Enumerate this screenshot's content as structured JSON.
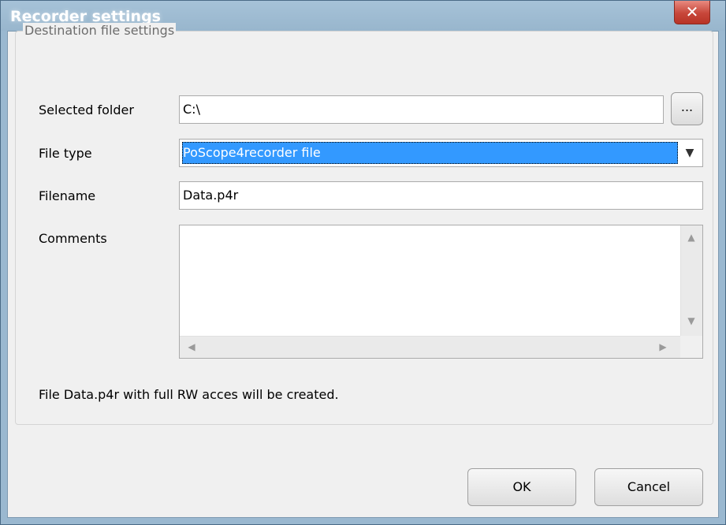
{
  "window": {
    "title": "Recorder settings",
    "close_symbol": "✕"
  },
  "group": {
    "legend": "Destination file settings"
  },
  "fields": {
    "folder_label": "Selected folder",
    "folder_value": "C:\\",
    "browse_label": "...",
    "filetype_label": "File type",
    "filetype_selected": "PoScope4recorder file",
    "filename_label": "Filename",
    "filename_value": "Data.p4r",
    "comments_label": "Comments",
    "comments_value": ""
  },
  "status": {
    "message": "File Data.p4r with full RW acces will be created."
  },
  "buttons": {
    "ok_label": "OK",
    "cancel_label": "Cancel"
  },
  "icons": {
    "close": "close-icon",
    "dropdown": "chevron-down-icon",
    "scroll_up": "arrow-up-icon",
    "scroll_down": "arrow-down-icon",
    "scroll_left": "arrow-left-icon",
    "scroll_right": "arrow-right-icon"
  },
  "colors": {
    "titlebar": "#9ab8d0",
    "close_button": "#c7463a",
    "selection": "#3399ff",
    "dialog_background": "#f0f0f0"
  }
}
